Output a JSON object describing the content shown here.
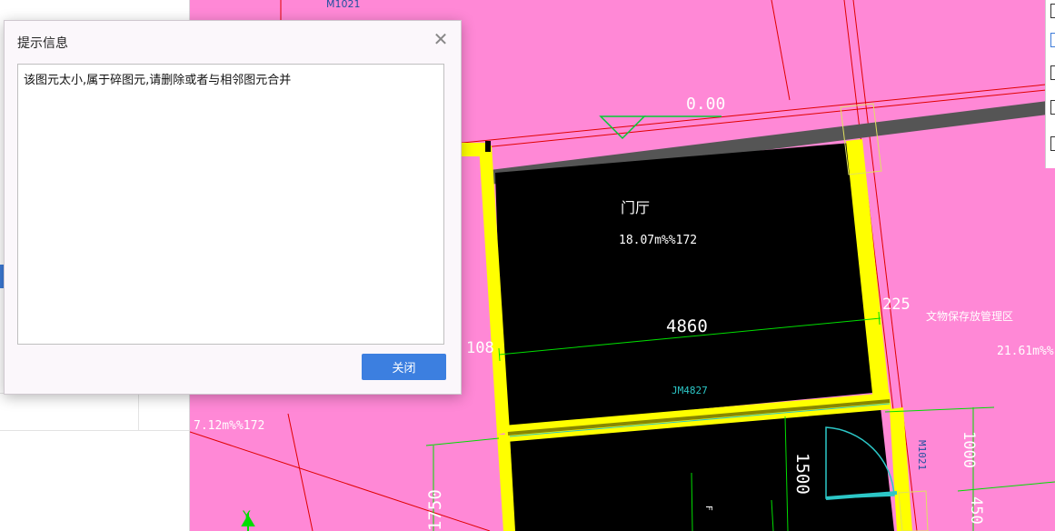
{
  "dialog": {
    "title": "提示信息",
    "message": "该图元太小,属于碎图元,请删除或者与相邻图元合并",
    "close_button": "关闭",
    "close_icon": "close-icon"
  },
  "cad": {
    "labels": {
      "door_top": "M1021",
      "elevation": "0.00",
      "room_name": "门厅",
      "room_area": "18.07m%%172",
      "dim_width": "4860",
      "dim_left": "108",
      "dim_right": "225",
      "window": "JM4827",
      "right_room_name": "文物保存放管理区",
      "right_room_area": "21.61m%%",
      "left_room_area": "7.12m%%172",
      "dim_1500": "1500",
      "dim_1750": "1750",
      "door_right": "M1021",
      "dim_1000": "1000",
      "dim_450": "450",
      "small_mark": "F",
      "axis_y": "Y"
    },
    "colors": {
      "background": "#ff88d6",
      "room": "#000000",
      "wall": "#ffff00",
      "dimension": "#00dd00",
      "axis": "#e00000"
    }
  }
}
